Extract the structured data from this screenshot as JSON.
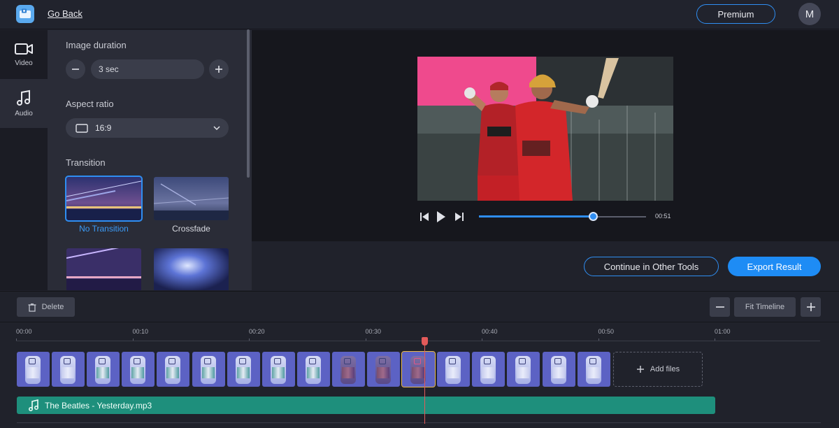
{
  "header": {
    "go_back": "Go Back",
    "premium": "Premium",
    "avatar_initial": "M"
  },
  "sidebar": {
    "items": [
      {
        "label": "Video",
        "icon": "video-camera-icon"
      },
      {
        "label": "Audio",
        "icon": "music-note-icon"
      }
    ]
  },
  "settings": {
    "image_duration_label": "Image duration",
    "image_duration_value": "3 sec",
    "aspect_ratio_label": "Aspect ratio",
    "aspect_ratio_value": "16:9",
    "transition_label": "Transition",
    "transitions": [
      {
        "label": "No Transition",
        "selected": true
      },
      {
        "label": "Crossfade",
        "selected": false
      }
    ]
  },
  "player": {
    "time": "00:51",
    "progress": 0.68
  },
  "actions": {
    "continue": "Continue in Other Tools",
    "export": "Export Result"
  },
  "timeline": {
    "delete": "Delete",
    "fit": "Fit Timeline",
    "ticks": [
      "00:00",
      "00:10",
      "00:20",
      "00:30",
      "00:40",
      "00:50",
      "01:00"
    ],
    "add_files": "Add files",
    "audio_track": "The Beatles - Yesterday.mp3"
  },
  "colors": {
    "accent": "#1e8cf5",
    "audio_track": "#1e8f7c",
    "clip": "#5c62c4",
    "playhead": "#e35a5a"
  }
}
